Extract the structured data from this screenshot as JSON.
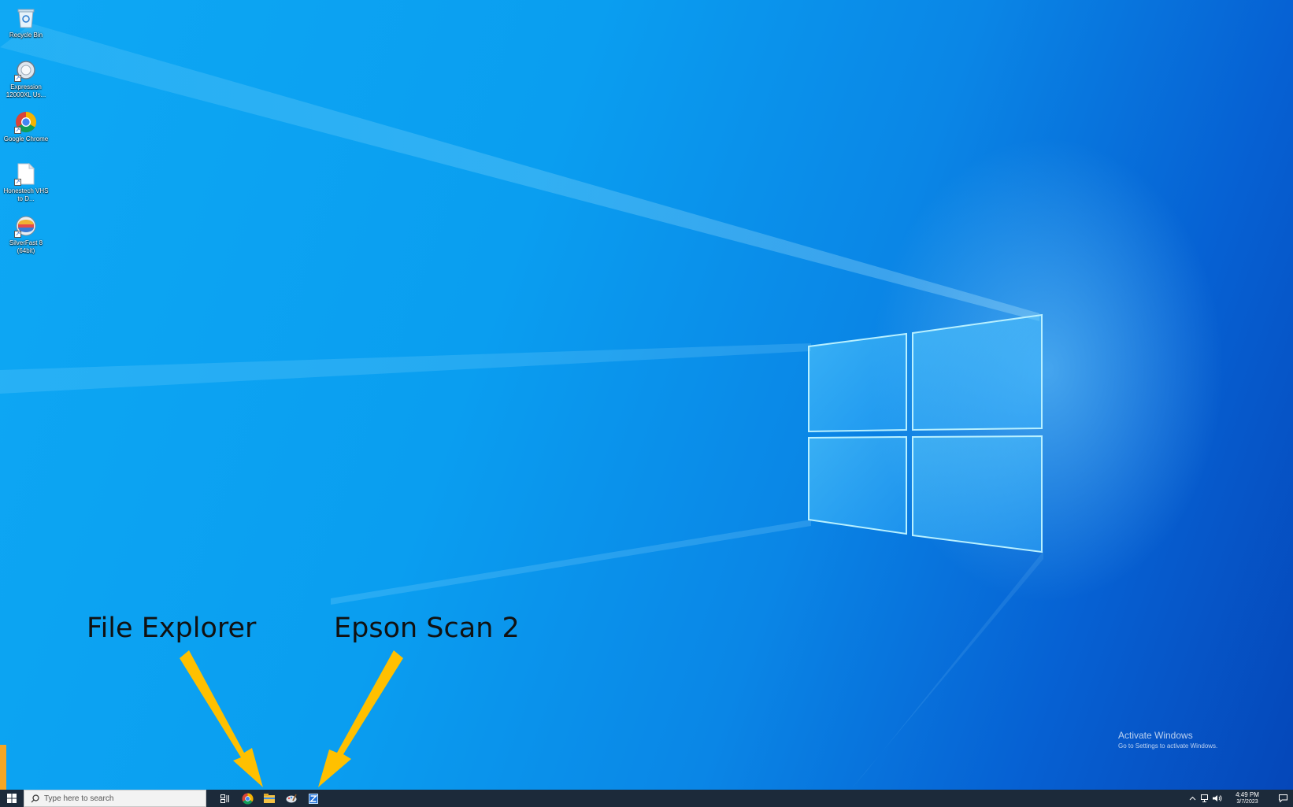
{
  "desktop": {
    "icons": [
      {
        "label": "Recycle Bin",
        "icon": "recycle-bin-icon"
      },
      {
        "label": "Expression 12000XL Us...",
        "icon": "scanner-utility-icon"
      },
      {
        "label": "Google Chrome",
        "icon": "chrome-icon"
      },
      {
        "label": "Honestech VHS to D...",
        "icon": "document-icon"
      },
      {
        "label": "SilverFast 8 (64bit)",
        "icon": "silverfast-icon"
      }
    ]
  },
  "annotations": {
    "file_explorer_label": "File Explorer",
    "epson_scan_label": "Epson Scan 2",
    "arrow_color": "#FFC000"
  },
  "watermark": {
    "title": "Activate Windows",
    "subtitle": "Go to Settings to activate Windows."
  },
  "taskbar": {
    "search_placeholder": "Type here to search",
    "apps": [
      "task-view-icon",
      "chrome-icon",
      "file-explorer-icon",
      "paint-icon",
      "epson-scan-icon"
    ],
    "clock_time": "4:49 PM",
    "clock_date": "3/7/2023",
    "background": "#1C2A3A"
  }
}
